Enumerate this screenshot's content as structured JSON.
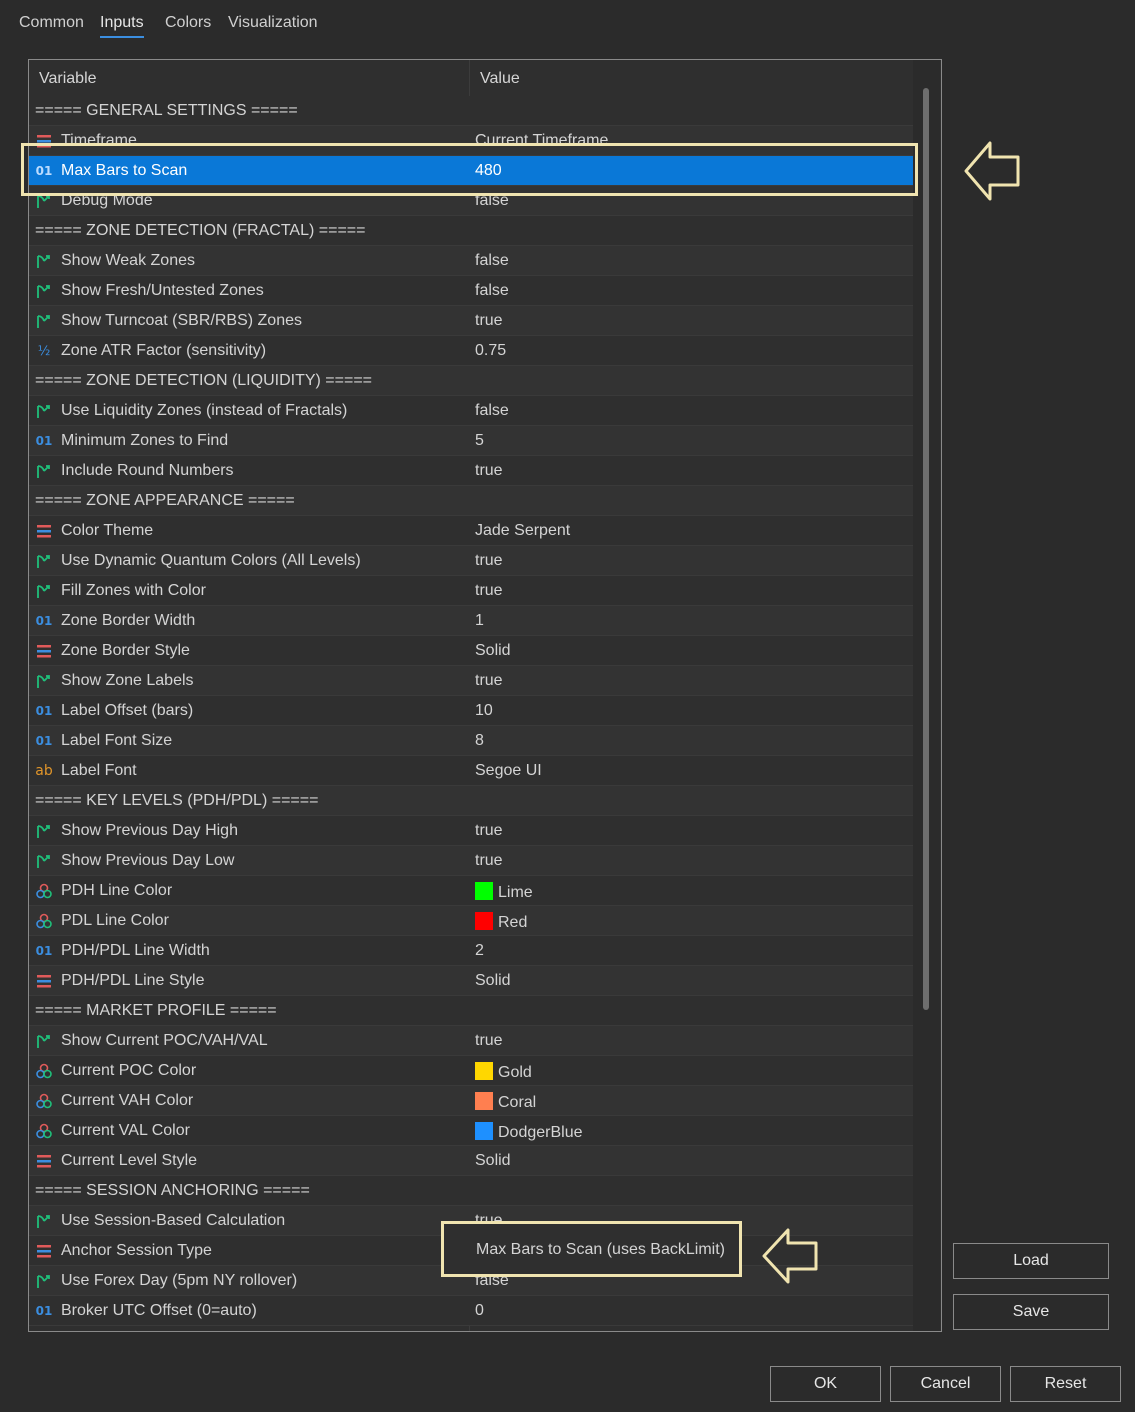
{
  "tabs": [
    {
      "label": "Common",
      "active": false
    },
    {
      "label": "Inputs",
      "active": true
    },
    {
      "label": "Colors",
      "active": false
    },
    {
      "label": "Visualization",
      "active": false
    }
  ],
  "grid": {
    "col_variable": "Variable",
    "col_value": "Value",
    "rows": [
      {
        "type": "section",
        "var": "===== GENERAL SETTINGS =====",
        "val": ""
      },
      {
        "type": "enum",
        "var": "Timeframe",
        "val": "Current Timeframe"
      },
      {
        "type": "int",
        "var": "Max Bars to Scan",
        "val": "480",
        "selected": true
      },
      {
        "type": "bool",
        "var": "Debug Mode",
        "val": "false"
      },
      {
        "type": "section",
        "var": "===== ZONE DETECTION (FRACTAL) =====",
        "val": ""
      },
      {
        "type": "bool",
        "var": "Show Weak Zones",
        "val": "false"
      },
      {
        "type": "bool",
        "var": "Show Fresh/Untested Zones",
        "val": "false"
      },
      {
        "type": "bool",
        "var": "Show Turncoat (SBR/RBS) Zones",
        "val": "true"
      },
      {
        "type": "double",
        "var": "Zone ATR Factor (sensitivity)",
        "val": "0.75"
      },
      {
        "type": "section",
        "var": "===== ZONE DETECTION (LIQUIDITY) =====",
        "val": ""
      },
      {
        "type": "bool",
        "var": "Use Liquidity Zones (instead of Fractals)",
        "val": "false"
      },
      {
        "type": "int",
        "var": "Minimum Zones to Find",
        "val": "5"
      },
      {
        "type": "bool",
        "var": "Include Round Numbers",
        "val": "true"
      },
      {
        "type": "section",
        "var": "===== ZONE APPEARANCE =====",
        "val": ""
      },
      {
        "type": "enum",
        "var": "Color Theme",
        "val": "Jade Serpent"
      },
      {
        "type": "bool",
        "var": "Use Dynamic Quantum Colors (All Levels)",
        "val": "true"
      },
      {
        "type": "bool",
        "var": "Fill Zones with Color",
        "val": "true"
      },
      {
        "type": "int",
        "var": "Zone Border Width",
        "val": "1"
      },
      {
        "type": "enum",
        "var": "Zone Border Style",
        "val": "Solid"
      },
      {
        "type": "bool",
        "var": "Show Zone Labels",
        "val": "true"
      },
      {
        "type": "int",
        "var": "Label Offset (bars)",
        "val": "10"
      },
      {
        "type": "int",
        "var": "Label Font Size",
        "val": "8"
      },
      {
        "type": "string",
        "var": "Label Font",
        "val": "Segoe UI"
      },
      {
        "type": "section",
        "var": "===== KEY LEVELS (PDH/PDL) =====",
        "val": ""
      },
      {
        "type": "bool",
        "var": "Show Previous Day High",
        "val": "true"
      },
      {
        "type": "bool",
        "var": "Show Previous Day Low",
        "val": "true"
      },
      {
        "type": "color",
        "var": "PDH Line Color",
        "val": "Lime",
        "swatch": "#00ff00"
      },
      {
        "type": "color",
        "var": "PDL Line Color",
        "val": "Red",
        "swatch": "#ff0000"
      },
      {
        "type": "int",
        "var": "PDH/PDL Line Width",
        "val": "2"
      },
      {
        "type": "enum",
        "var": "PDH/PDL Line Style",
        "val": "Solid"
      },
      {
        "type": "section",
        "var": "===== MARKET PROFILE =====",
        "val": ""
      },
      {
        "type": "bool",
        "var": "Show Current POC/VAH/VAL",
        "val": "true"
      },
      {
        "type": "color",
        "var": "Current POC Color",
        "val": "Gold",
        "swatch": "#ffd700"
      },
      {
        "type": "color",
        "var": "Current VAH Color",
        "val": "Coral",
        "swatch": "#ff7f50"
      },
      {
        "type": "color",
        "var": "Current VAL Color",
        "val": "DodgerBlue",
        "swatch": "#1e90ff"
      },
      {
        "type": "enum",
        "var": "Current Level Style",
        "val": "Solid"
      },
      {
        "type": "section",
        "var": "===== SESSION ANCHORING =====",
        "val": ""
      },
      {
        "type": "bool",
        "var": "Use Session-Based Calculation",
        "val": "true"
      },
      {
        "type": "enum",
        "var": "Anchor Session Type",
        "val": ""
      },
      {
        "type": "bool",
        "var": "Use Forex Day (5pm NY rollover)",
        "val": "false"
      },
      {
        "type": "int",
        "var": "Broker UTC Offset (0=auto)",
        "val": "0"
      }
    ]
  },
  "annotation": {
    "callout_text": "Max Bars to Scan (uses BackLimit)",
    "box_color": "#f0e4b0"
  },
  "side_buttons": {
    "load": "Load",
    "save": "Save"
  },
  "footer_buttons": {
    "ok": "OK",
    "cancel": "Cancel",
    "reset": "Reset"
  },
  "icons": {
    "int": "01",
    "bool": "bool-arrow-icon",
    "enum": "enum-list-icon",
    "double": "½",
    "string": "ab",
    "color": "color-circles-icon"
  },
  "colors": {
    "selection": "#0a78d7",
    "background": "#2b2b2b",
    "accent": "#3b8ee0"
  }
}
